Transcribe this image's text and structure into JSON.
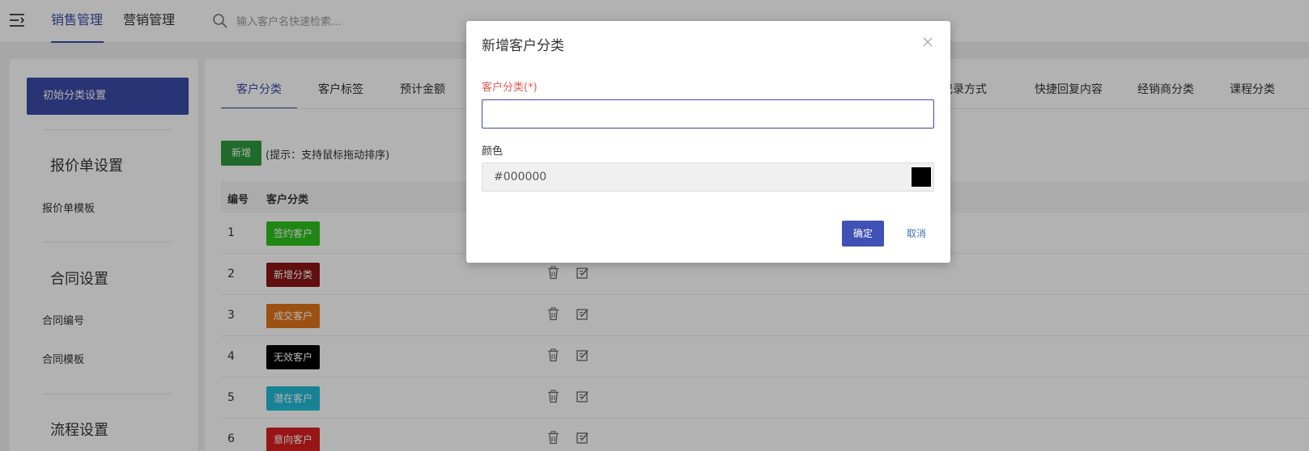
{
  "topnav": {
    "tabs": [
      {
        "label": "销售管理",
        "active": true
      },
      {
        "label": "营销管理",
        "active": false
      }
    ],
    "search_placeholder": "输入客户名快速检索..."
  },
  "sidebar": {
    "active_item": "初始分类设置",
    "sections": [
      {
        "title": "报价单设置",
        "items": [
          "报价单模板"
        ]
      },
      {
        "title": "合同设置",
        "items": [
          "合同编号",
          "合同模板"
        ]
      },
      {
        "title": "流程设置",
        "items": []
      }
    ]
  },
  "main": {
    "tabs": [
      "客户分类",
      "客户标签",
      "预计金额",
      "记录方式",
      "快捷回复内容",
      "经销商分类",
      "课程分类"
    ],
    "active_tab": "客户分类",
    "add_button": "新增",
    "hint": "(提示：支持鼠标拖动排序)",
    "columns": [
      "编号",
      "客户分类"
    ],
    "rows": [
      {
        "num": "1",
        "name": "签约客户",
        "color": "#2ec11e"
      },
      {
        "num": "2",
        "name": "新增分类",
        "color": "#8b1616"
      },
      {
        "num": "3",
        "name": "成交客户",
        "color": "#e0741a"
      },
      {
        "num": "4",
        "name": "无效客户",
        "color": "#000000"
      },
      {
        "num": "5",
        "name": "潜在客户",
        "color": "#22bcd6"
      },
      {
        "num": "6",
        "name": "意向客户",
        "color": "#d91f1f"
      }
    ]
  },
  "modal": {
    "title": "新增客户分类",
    "category_label": "客户分类(*)",
    "category_value": "",
    "color_label": "颜色",
    "color_value": "#000000",
    "ok_label": "确定",
    "cancel_label": "取消"
  },
  "colors": {
    "accent": "#3b4ba8",
    "add_button": "#2e9a3e",
    "required_label": "#e8574f"
  }
}
